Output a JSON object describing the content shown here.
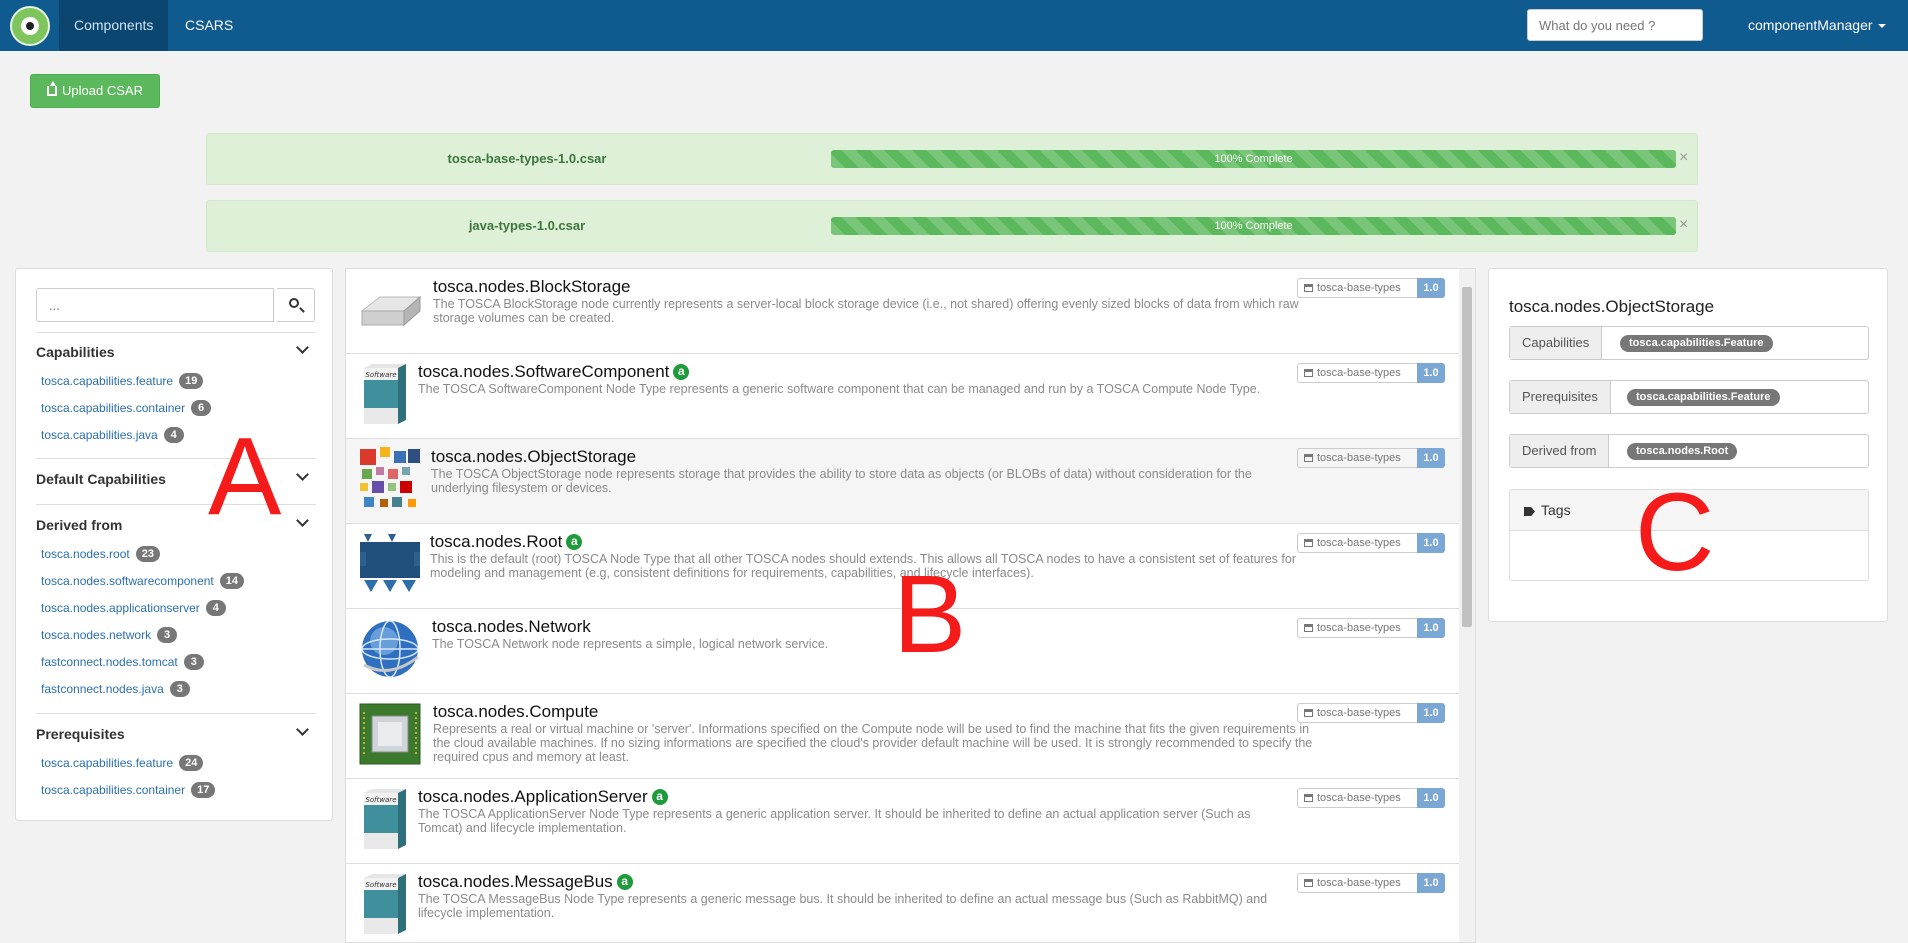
{
  "navbar": {
    "tabs": [
      "Components",
      "CSARS"
    ],
    "search_placeholder": "What do you need ?",
    "user": "componentManager"
  },
  "upload_button": "Upload CSAR",
  "uploads": [
    {
      "name": "tosca-base-types-1.0.csar",
      "progress_label": "100% Complete",
      "progress": 100
    },
    {
      "name": "java-types-1.0.csar",
      "progress_label": "100% Complete",
      "progress": 100
    }
  ],
  "facets": {
    "search_placeholder": "...",
    "groups": [
      {
        "title": "Capabilities",
        "items": [
          {
            "label": "tosca.capabilities.feature",
            "count": "19"
          },
          {
            "label": "tosca.capabilities.container",
            "count": "6"
          },
          {
            "label": "tosca.capabilities.java",
            "count": "4"
          }
        ]
      },
      {
        "title": "Default Capabilities",
        "items": []
      },
      {
        "title": "Derived from",
        "items": [
          {
            "label": "tosca.nodes.root",
            "count": "23"
          },
          {
            "label": "tosca.nodes.softwarecomponent",
            "count": "14"
          },
          {
            "label": "tosca.nodes.applicationserver",
            "count": "4"
          },
          {
            "label": "tosca.nodes.network",
            "count": "3"
          },
          {
            "label": "fastconnect.nodes.tomcat",
            "count": "3"
          },
          {
            "label": "fastconnect.nodes.java",
            "count": "3"
          }
        ]
      },
      {
        "title": "Prerequisites",
        "items": [
          {
            "label": "tosca.capabilities.feature",
            "count": "24"
          },
          {
            "label": "tosca.capabilities.container",
            "count": "17"
          }
        ]
      }
    ]
  },
  "components": [
    {
      "name": "tosca.nodes.BlockStorage",
      "abstract": false,
      "icon": "block-storage-icon",
      "desc": "The TOSCA BlockStorage node currently represents a server-local block storage device (i.e., not shared) offering evenly sized blocks of data from which raw storage volumes can be created.",
      "archive": "tosca-base-types",
      "version": "1.0"
    },
    {
      "name": "tosca.nodes.SoftwareComponent",
      "abstract": true,
      "icon": "software-box-icon",
      "desc": "The TOSCA SoftwareComponent Node Type represents a generic software component that can be managed and run by a TOSCA Compute Node Type.",
      "archive": "tosca-base-types",
      "version": "1.0"
    },
    {
      "name": "tosca.nodes.ObjectStorage",
      "abstract": false,
      "icon": "object-storage-icon",
      "desc": "The TOSCA ObjectStorage node represents storage that provides the ability to store data as objects (or BLOBs of data) without consideration for the underlying filesystem or devices.",
      "archive": "tosca-base-types",
      "version": "1.0"
    },
    {
      "name": "tosca.nodes.Root",
      "abstract": true,
      "icon": "root-node-icon",
      "desc": "This is the default (root) TOSCA Node Type that all other TOSCA nodes should extends. This allows all TOSCA nodes to have a consistent set of features for modeling and management (e.g, consistent definitions for requirements, capabilities, and lifecycle interfaces).",
      "archive": "tosca-base-types",
      "version": "1.0"
    },
    {
      "name": "tosca.nodes.Network",
      "abstract": false,
      "icon": "globe-icon",
      "desc": "The TOSCA Network node represents a simple, logical network service.",
      "archive": "tosca-base-types",
      "version": "1.0"
    },
    {
      "name": "tosca.nodes.Compute",
      "abstract": false,
      "icon": "chip-icon",
      "desc": "Represents a real or virtual machine or 'server'. Informations specified on the Compute node will be used to find the machine that fits the given requirements in the cloud available machines. If no sizing informations are specified the cloud's provider default machine will be used. It is strongly recommended to specify the required cpus and memory at least.",
      "archive": "tosca-base-types",
      "version": "1.0"
    },
    {
      "name": "tosca.nodes.ApplicationServer",
      "abstract": true,
      "icon": "software-box-icon",
      "desc": "The TOSCA ApplicationServer Node Type represents a generic application server. It should be inherited to define an actual application server (Such as Tomcat) and lifecycle implementation.",
      "archive": "tosca-base-types",
      "version": "1.0"
    },
    {
      "name": "tosca.nodes.MessageBus",
      "abstract": true,
      "icon": "software-box-icon",
      "desc": "The TOSCA MessageBus Node Type represents a generic message bus. It should be inherited to define an actual message bus (Such as RabbitMQ) and lifecycle implementation.",
      "archive": "tosca-base-types",
      "version": "1.0"
    }
  ],
  "abstract_badge": "a",
  "software_box_label": "Software",
  "details": {
    "title": "tosca.nodes.ObjectStorage",
    "capabilities_label": "Capabilities",
    "capabilities_value": "tosca.capabilities.Feature",
    "prerequisites_label": "Prerequisites",
    "prerequisites_value": "tosca.capabilities.Feature",
    "derived_label": "Derived from",
    "derived_value": "tosca.nodes.Root",
    "tags_label": "Tags"
  },
  "markers": {
    "a": "A",
    "b": "B",
    "c": "C"
  },
  "colors": {
    "navbar": "#0f5a8e",
    "success": "#5cb85c",
    "link": "#2a6fb0",
    "marker": "#f51b1b"
  }
}
